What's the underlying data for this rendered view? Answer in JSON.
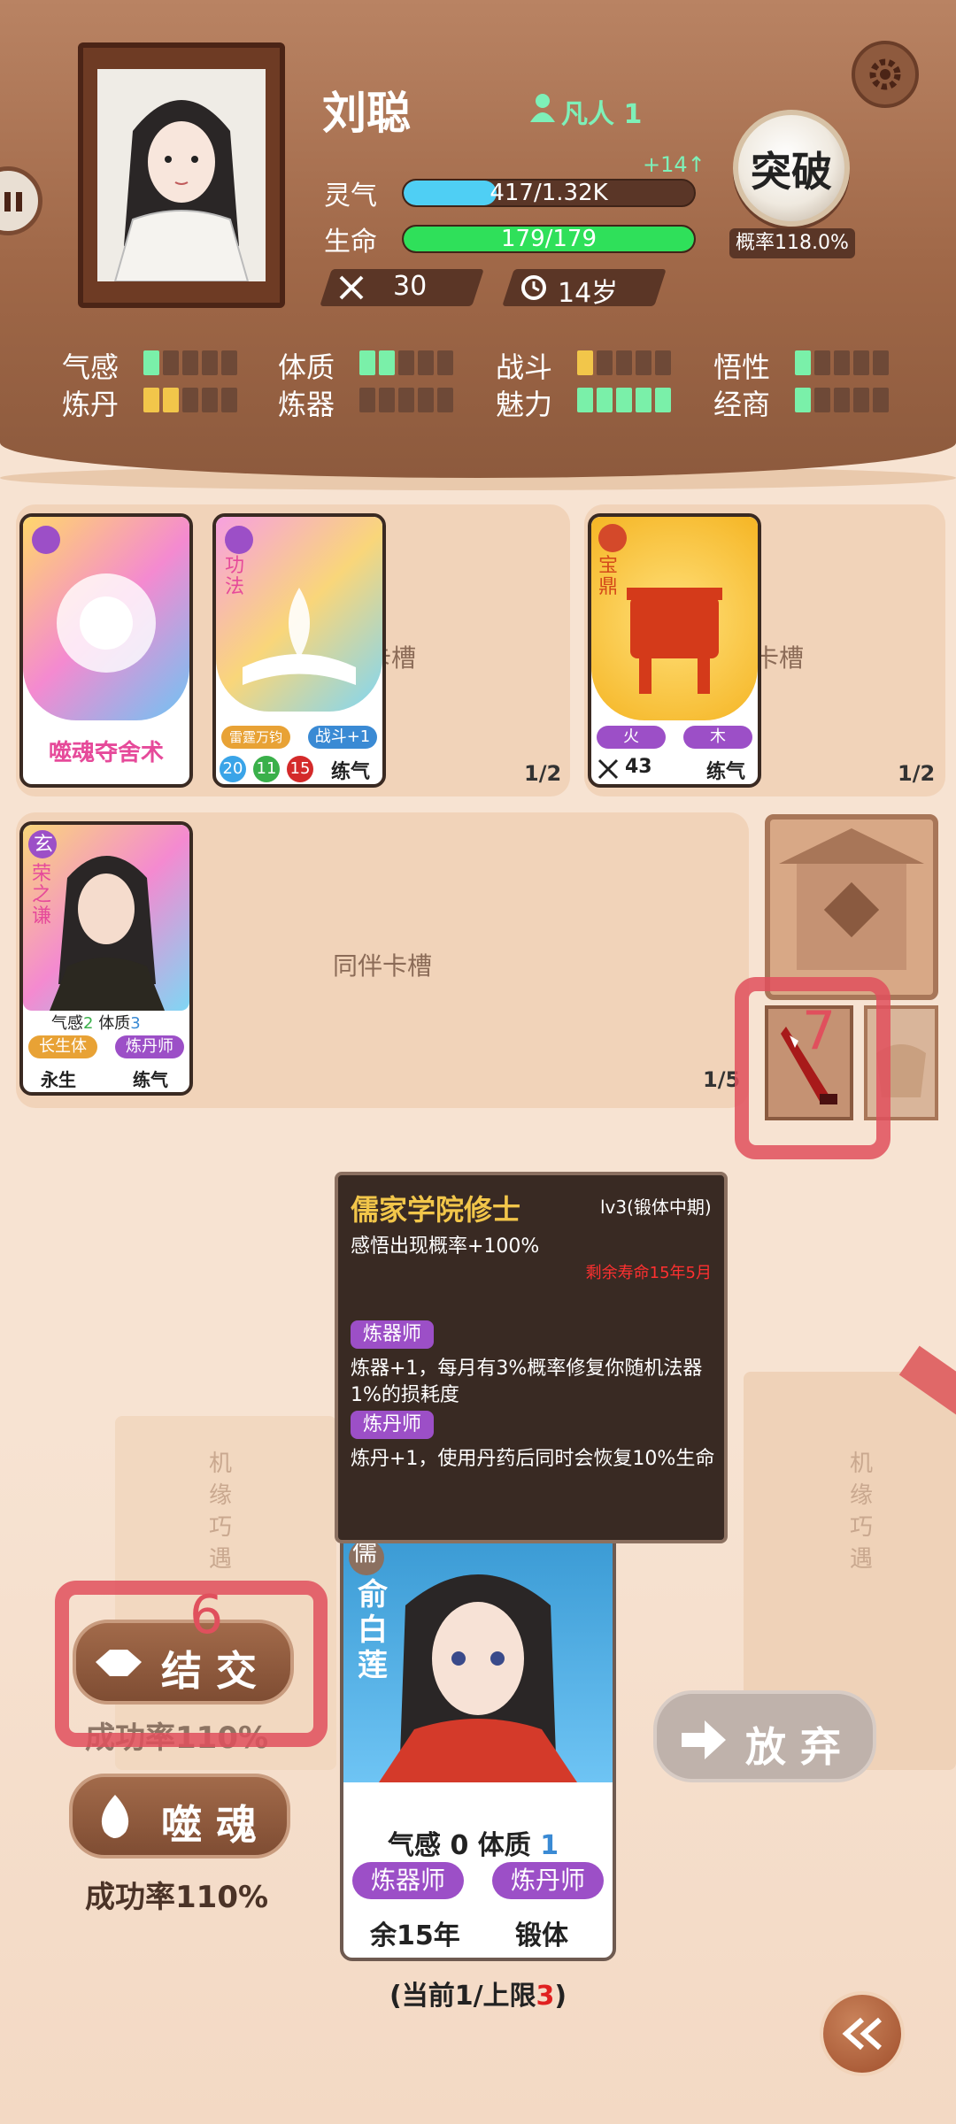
{
  "player": {
    "name": "刘聪",
    "rank": "凡人 1",
    "avatar_icon": "person-icon"
  },
  "stats": {
    "lingqi_label": "灵气",
    "lingqi_value": "417/1.32K",
    "lingqi_fill": 0.32,
    "lingqi_gain": "+14↑",
    "life_label": "生命",
    "life_value": "179/179",
    "life_fill": 1.0,
    "combat_value": "30",
    "age_value": "14岁"
  },
  "breakthrough": {
    "label": "突破",
    "probability": "概率118.0%"
  },
  "attributes": [
    {
      "label": "气感",
      "level": 1,
      "color": "#7af0a9"
    },
    {
      "label": "体质",
      "level": 2,
      "color": "#7af0a9"
    },
    {
      "label": "战斗",
      "level": 1,
      "color": "#f2c64a"
    },
    {
      "label": "悟性",
      "level": 1,
      "color": "#7af0a9"
    },
    {
      "label": "炼丹",
      "level": 2,
      "color": "#f2c64a"
    },
    {
      "label": "炼器",
      "level": 0,
      "color": "#7af0a9"
    },
    {
      "label": "魅力",
      "level": 5,
      "color": "#7af0a9"
    },
    {
      "label": "经商",
      "level": 1,
      "color": "#7af0a9"
    }
  ],
  "slots": {
    "skill": {
      "label": "卡槽",
      "count": "1/2",
      "card1": {
        "name": "噬魂夺舍术"
      },
      "card2": {
        "type": "功法",
        "tag1": "雷霆万钧",
        "tag2": "战斗+1",
        "n1": "20",
        "n2": "11",
        "n3": "15",
        "realm": "练气"
      }
    },
    "treasure": {
      "label": "卡槽",
      "count": "1/2",
      "card": {
        "type": "宝鼎",
        "tag1": "火",
        "tag2": "木",
        "power": "43",
        "realm": "练气"
      }
    },
    "companion": {
      "label": "同伴卡槽",
      "count": "1/5",
      "card": {
        "badge": "玄",
        "name": "荣之谦",
        "qigan_label": "气感",
        "qigan": "2",
        "tizhi_label": "体质",
        "tizhi": "3",
        "tag1": "长生体",
        "tag2": "炼丹师",
        "life": "永生",
        "realm": "练气"
      }
    }
  },
  "tooltip": {
    "title": "儒家学院修士",
    "level": "lv3(锻体中期)",
    "desc": "感悟出现概率+100%",
    "remaining": "剩余寿命15年5月",
    "trait1": "炼器师",
    "trait1_desc": "炼器+1，每月有3%概率修复你随机法器1%的损耗度",
    "trait2": "炼丹师",
    "trait2_desc": "炼丹+1，使用丹药后同时会恢复10%生命"
  },
  "encounter": {
    "badge": "儒",
    "name": "俞白莲",
    "qigan_label": "气感",
    "qigan": "0",
    "tizhi_label": "体质",
    "tizhi": "1",
    "tag1": "炼器师",
    "tag2": "炼丹师",
    "life": "余15年",
    "realm": "锻体",
    "limit_prefix": "(当前1/上限",
    "limit_max": "3",
    "limit_suffix": ")"
  },
  "actions": {
    "befriend": "结 交",
    "befriend_rate": "成功率110%",
    "devour": "噬 魂",
    "devour_rate": "成功率110%",
    "abandon": "放 弃"
  },
  "shop": {
    "sign_left": "机缘巧遇",
    "sign_right": "机缘巧遇"
  },
  "markers": {
    "m1": "6",
    "m2": "7"
  }
}
